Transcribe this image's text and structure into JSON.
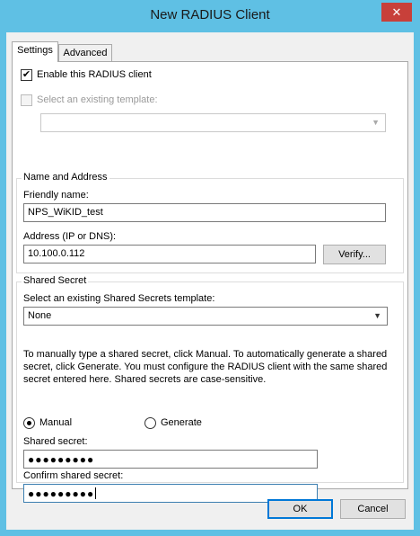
{
  "window": {
    "title": "New RADIUS Client",
    "close_glyph": "✕"
  },
  "tabs": [
    {
      "label": "Settings",
      "selected": true
    },
    {
      "label": "Advanced",
      "selected": false
    }
  ],
  "settings": {
    "enable_label": "Enable this RADIUS client",
    "enable_checked": true,
    "template_label": "Select an existing template:",
    "template_checked": false,
    "template_value": "",
    "name_address": {
      "legend": "Name and Address",
      "friendly_label": "Friendly name:",
      "friendly_value": "NPS_WiKID_test",
      "address_label": "Address (IP or DNS):",
      "address_value": "10.100.0.112",
      "verify_label": "Verify..."
    },
    "shared_secret": {
      "legend": "Shared Secret",
      "template_label": "Select an existing Shared Secrets template:",
      "template_value": "None",
      "description": "To manually type a shared secret, click Manual. To automatically generate a shared secret, click Generate. You must configure the RADIUS client with the same shared secret entered here. Shared secrets are case-sensitive.",
      "manual_label": "Manual",
      "generate_label": "Generate",
      "selected_mode": "Manual",
      "secret_label": "Shared secret:",
      "secret_value": "●●●●●●●●●",
      "confirm_label": "Confirm shared secret:",
      "confirm_value": "●●●●●●●●●"
    }
  },
  "footer": {
    "ok_label": "OK",
    "cancel_label": "Cancel"
  },
  "icons": {
    "checkmark": "✔",
    "dropdown": "▼"
  }
}
